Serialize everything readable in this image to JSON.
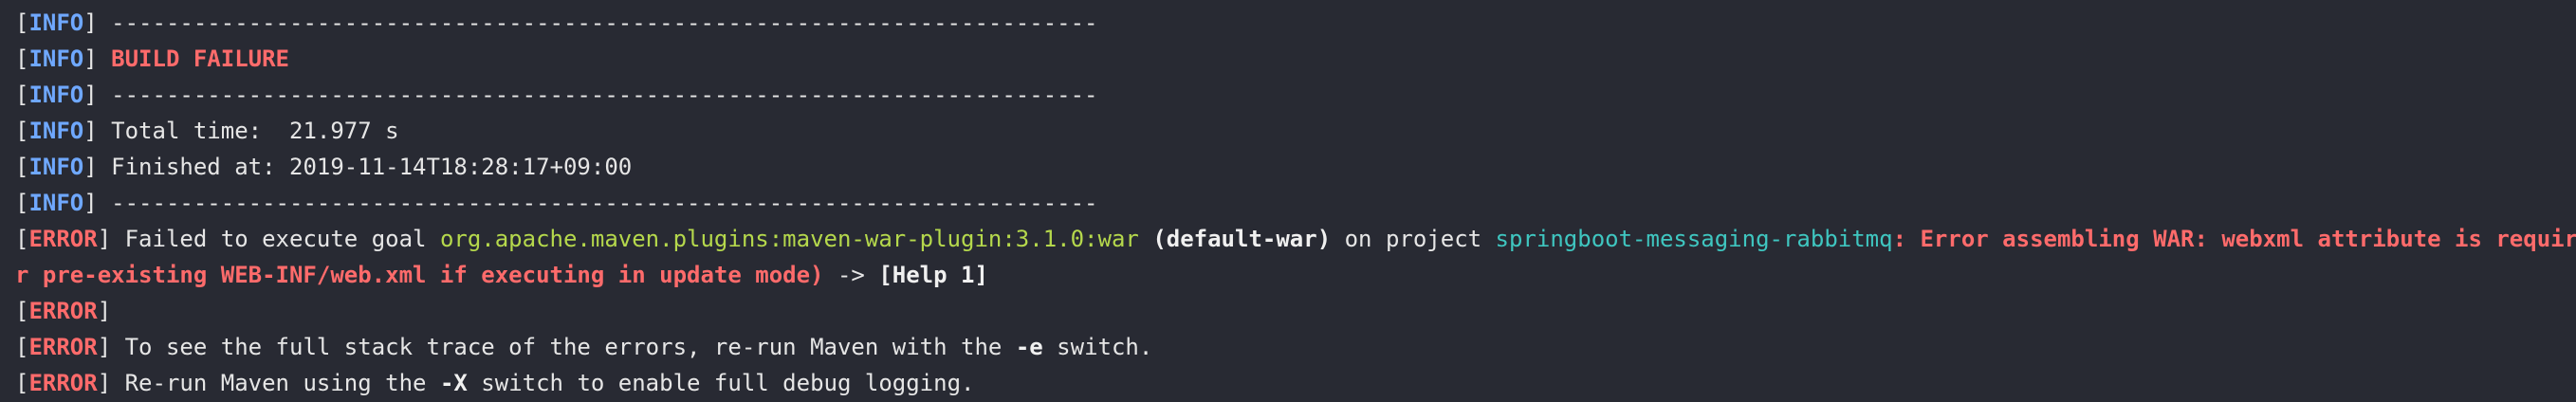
{
  "window": {
    "background": "#282a33"
  },
  "colors": {
    "info_level": "#6fa8ff",
    "error_level": "#ff6b6b",
    "failure": "#ff6b6b",
    "plugin": "#b5d84c",
    "project": "#3fc6c0",
    "text": "#e6e6e6"
  },
  "lines": [
    {
      "level": "INFO",
      "segments": [
        {
          "style": "plain",
          "text": " ------------------------------------------------------------------------"
        }
      ]
    },
    {
      "level": "INFO",
      "segments": [
        {
          "style": "plain",
          "text": " "
        },
        {
          "style": "fail",
          "text": "BUILD FAILURE"
        }
      ]
    },
    {
      "level": "INFO",
      "segments": [
        {
          "style": "plain",
          "text": " ------------------------------------------------------------------------"
        }
      ]
    },
    {
      "level": "INFO",
      "segments": [
        {
          "style": "plain",
          "text": " Total time:  21.977 s"
        }
      ]
    },
    {
      "level": "INFO",
      "segments": [
        {
          "style": "plain",
          "text": " Finished at: 2019-11-14T18:28:17+09:00"
        }
      ]
    },
    {
      "level": "INFO",
      "segments": [
        {
          "style": "plain",
          "text": " ------------------------------------------------------------------------"
        }
      ]
    },
    {
      "level": "ERROR",
      "segments": [
        {
          "style": "plain",
          "text": " Failed to execute goal "
        },
        {
          "style": "green",
          "text": "org.apache.maven.plugins:maven-war-plugin:3.1.0:war"
        },
        {
          "style": "plain",
          "text": " "
        },
        {
          "style": "boldwhite",
          "text": "(default-war)"
        },
        {
          "style": "plain",
          "text": " on project "
        },
        {
          "style": "teal",
          "text": "springboot-messaging-rabbitmq"
        },
        {
          "style": "red",
          "text": ": Error assembling WAR: webxml attribute is required (o"
        }
      ]
    },
    {
      "level": "",
      "segments": [
        {
          "style": "red",
          "text": "r pre-existing WEB-INF/web.xml if executing in update mode)"
        },
        {
          "style": "plain",
          "text": " -> "
        },
        {
          "style": "boldwhite",
          "text": "[Help 1]"
        }
      ]
    },
    {
      "level": "ERROR",
      "segments": []
    },
    {
      "level": "ERROR",
      "segments": [
        {
          "style": "plain",
          "text": " To see the full stack trace of the errors, re-run Maven with the "
        },
        {
          "style": "boldwhite",
          "text": "-e"
        },
        {
          "style": "plain",
          "text": " switch."
        }
      ]
    },
    {
      "level": "ERROR",
      "segments": [
        {
          "style": "plain",
          "text": " Re-run Maven using the "
        },
        {
          "style": "boldwhite",
          "text": "-X"
        },
        {
          "style": "plain",
          "text": " switch to enable full debug logging."
        }
      ]
    }
  ]
}
